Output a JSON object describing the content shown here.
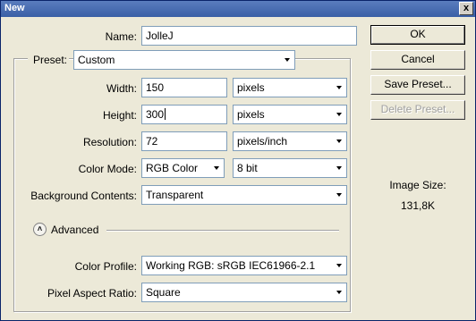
{
  "window": {
    "title": "New",
    "close_symbol": "x"
  },
  "name": {
    "label": "Name:",
    "value": "JolleJ"
  },
  "preset": {
    "label": "Preset:",
    "value": "Custom"
  },
  "width": {
    "label": "Width:",
    "value": "150",
    "unit": "pixels"
  },
  "height": {
    "label": "Height:",
    "value": "300",
    "unit": "pixels"
  },
  "resolution": {
    "label": "Resolution:",
    "value": "72",
    "unit": "pixels/inch"
  },
  "color_mode": {
    "label": "Color Mode:",
    "value": "RGB Color",
    "depth": "8 bit"
  },
  "background": {
    "label": "Background Contents:",
    "value": "Transparent"
  },
  "advanced": {
    "label": "Advanced",
    "icon": "collapse-up-icon"
  },
  "color_profile": {
    "label": "Color Profile:",
    "value": "Working RGB:  sRGB IEC61966-2.1"
  },
  "pixel_aspect": {
    "label": "Pixel Aspect Ratio:",
    "value": "Square"
  },
  "buttons": {
    "ok": "OK",
    "cancel": "Cancel",
    "save_preset": "Save Preset...",
    "delete_preset": "Delete Preset..."
  },
  "image_size": {
    "label": "Image Size:",
    "value": "131,8K"
  }
}
